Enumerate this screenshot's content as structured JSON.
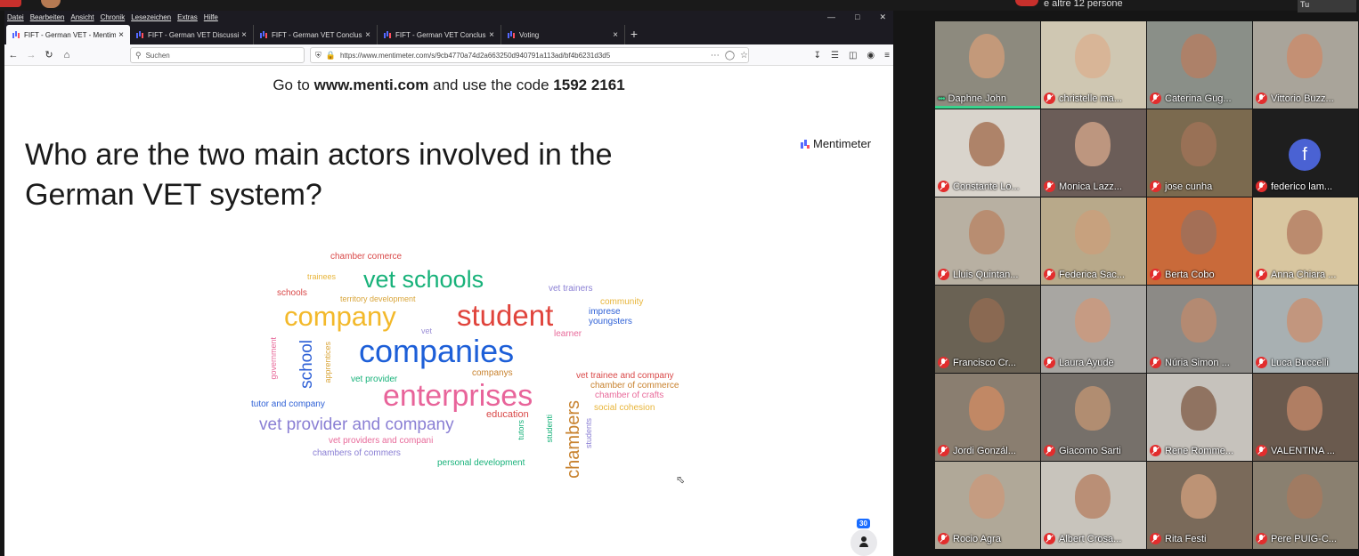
{
  "browser": {
    "menu": [
      "Datei",
      "Bearbeiten",
      "Ansicht",
      "Chronik",
      "Lesezeichen",
      "Extras",
      "Hilfe"
    ],
    "tabs": [
      {
        "label": "FIFT - German VET - Mentimeter",
        "active": true
      },
      {
        "label": "FIFT - German VET Discussion",
        "active": false
      },
      {
        "label": "FIFT - German VET Conclusion",
        "active": false
      },
      {
        "label": "FIFT - German VET Conclusion",
        "active": false
      },
      {
        "label": "Voting",
        "active": false
      }
    ],
    "search_placeholder": "Suchen",
    "url": "https://www.mentimeter.com/s/9cb4770a74d2a663250d940791a113ad/bf4b6231d3d5"
  },
  "slide": {
    "instr_prefix": "Go to ",
    "instr_site": "www.menti.com",
    "instr_middle": " and use the code ",
    "instr_code": "1592 2161",
    "question": "Who are the two main actors involved in the German VET system?",
    "brand": "Mentimeter",
    "participant_count": "30"
  },
  "word_cloud": [
    {
      "text": "chamber comerce",
      "color": "#d94848"
    },
    {
      "text": "trainees",
      "color": "#e8b53a"
    },
    {
      "text": "vet schools",
      "color": "#18b27a"
    },
    {
      "text": "schools",
      "color": "#d94848"
    },
    {
      "text": "territory development",
      "color": "#d9a53a"
    },
    {
      "text": "vet trainers",
      "color": "#8a7fd4"
    },
    {
      "text": "community",
      "color": "#e8b53a"
    },
    {
      "text": "company",
      "color": "#f3b92b"
    },
    {
      "text": "student",
      "color": "#e0443c"
    },
    {
      "text": "imprese",
      "color": "#2e60d6"
    },
    {
      "text": "youngsters",
      "color": "#2e60d6"
    },
    {
      "text": "vet",
      "color": "#9b8fd6"
    },
    {
      "text": "learner",
      "color": "#e86a9a"
    },
    {
      "text": "companies",
      "color": "#1d5fd8"
    },
    {
      "text": "government",
      "color": "#e86a9a"
    },
    {
      "text": "school",
      "color": "#2e60d6"
    },
    {
      "text": "apprentices",
      "color": "#d9a53a"
    },
    {
      "text": "companys",
      "color": "#c8822e"
    },
    {
      "text": "vet provider",
      "color": "#18b27a"
    },
    {
      "text": "vet trainee and company",
      "color": "#d94848"
    },
    {
      "text": "chamber of commerce",
      "color": "#c8822e"
    },
    {
      "text": "enterprises",
      "color": "#e8649a"
    },
    {
      "text": "chamber of crafts",
      "color": "#e86a9a"
    },
    {
      "text": "tutor and company",
      "color": "#2e60d6"
    },
    {
      "text": "social cohesion",
      "color": "#e8b53a"
    },
    {
      "text": "education",
      "color": "#d94848"
    },
    {
      "text": "vet provider and company",
      "color": "#8a7fd4"
    },
    {
      "text": "tutors",
      "color": "#18b27a"
    },
    {
      "text": "studenti",
      "color": "#18b27a"
    },
    {
      "text": "chambers",
      "color": "#c8822e"
    },
    {
      "text": "students",
      "color": "#8a7fd4"
    },
    {
      "text": "vet providers and compani",
      "color": "#e86a9a"
    },
    {
      "text": "chambers of commers",
      "color": "#8a7fd4"
    },
    {
      "text": "personal development",
      "color": "#18b27a"
    }
  ],
  "meeting": {
    "top_text": "e altre 12 persone",
    "self_label": "Tu",
    "participants": [
      {
        "name": "Daphne John",
        "muted": false,
        "speaking": true,
        "bg": "#8d8a7e",
        "skin": "#c99a7a"
      },
      {
        "name": "christelle ma...",
        "muted": true,
        "bg": "#cfc7b2",
        "skin": "#d8b394"
      },
      {
        "name": "Caterina Gug...",
        "muted": true,
        "bg": "#8a8f88",
        "skin": "#b08066"
      },
      {
        "name": "Vittorio Buzz...",
        "muted": true,
        "bg": "#a9a49a",
        "skin": "#c78e70"
      },
      {
        "name": "Constante Lo...",
        "muted": true,
        "bg": "#d9d4cc",
        "skin": "#a87a5e"
      },
      {
        "name": "Monica Lazz...",
        "muted": true,
        "bg": "#6b5d58",
        "skin": "#c69c84"
      },
      {
        "name": "jose cunha",
        "muted": true,
        "bg": "#7b6a4f",
        "skin": "#9c7256"
      },
      {
        "name": "federico lam...",
        "muted": true,
        "bg": "#1e1e1e",
        "avatar": "f"
      },
      {
        "name": "Lluis Quintan...",
        "muted": true,
        "bg": "#b8b0a2",
        "skin": "#b88a6c"
      },
      {
        "name": "Federica Sac...",
        "muted": true,
        "bg": "#b8a98a",
        "skin": "#c9a07c"
      },
      {
        "name": "Berta Cobo",
        "muted": true,
        "bg": "#c96a3a",
        "skin": "#a0705a"
      },
      {
        "name": "Anna Chiara ...",
        "muted": true,
        "bg": "#d8c6a0",
        "skin": "#b88468"
      },
      {
        "name": "Francisco Cr...",
        "muted": true,
        "bg": "#6a6254",
        "skin": "#8e6a52"
      },
      {
        "name": "Laura Ayude",
        "muted": true,
        "bg": "#a8a6a2",
        "skin": "#c99a80"
      },
      {
        "name": "Núria Simon ...",
        "muted": true,
        "bg": "#8c8a86",
        "skin": "#b88a70"
      },
      {
        "name": "Luca Buccelli",
        "muted": true,
        "bg": "#a8b0b2",
        "skin": "#c49478"
      },
      {
        "name": "Jordi Gonzál...",
        "muted": true,
        "bg": "#8a7e70",
        "skin": "#c68a64"
      },
      {
        "name": "Giacomo Sarti",
        "muted": true,
        "bg": "#76706a",
        "skin": "#b89072"
      },
      {
        "name": "Rene Romme...",
        "muted": true,
        "bg": "#c6c2bc",
        "skin": "#8a6a56"
      },
      {
        "name": "VALENTINA ...",
        "muted": true,
        "bg": "#6a5a4e",
        "skin": "#b88266"
      },
      {
        "name": "Rocio Agra",
        "muted": true,
        "bg": "#b0a898",
        "skin": "#c89a7e"
      },
      {
        "name": "Albert Crosa...",
        "muted": true,
        "bg": "#c8c4bc",
        "skin": "#b88a6e"
      },
      {
        "name": "Rita Festi",
        "muted": true,
        "bg": "#7a6a5a",
        "skin": "#c49878"
      },
      {
        "name": "Pere PUIG-C...",
        "muted": true,
        "bg": "#8a8070",
        "skin": "#a27a60"
      }
    ]
  }
}
